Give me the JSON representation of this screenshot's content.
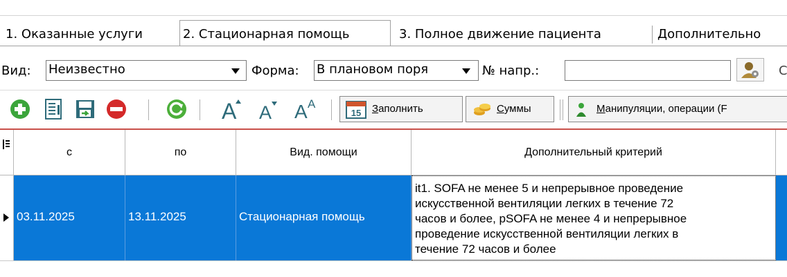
{
  "tabs": [
    {
      "label": "1. Оказанные услуги",
      "active": false
    },
    {
      "label": "2. Стационарная помощь",
      "active": true
    },
    {
      "label": "3. Полное движение пациента",
      "active": false
    },
    {
      "label": "Дополнительно",
      "active": false
    }
  ],
  "form": {
    "vid_label": "Вид:",
    "vid_value": "Неизвестно",
    "forma_label": "Форма:",
    "forma_value": "В плановом поря",
    "napr_label": "№ напр.:",
    "napr_value": "",
    "trailing_label": "С"
  },
  "toolbar": {
    "fill_key": "З",
    "fill_rest": "аполнить",
    "sums_key": "С",
    "sums_rest": "уммы",
    "manip_key": "М",
    "manip_rest": "анипуляции, операции (F",
    "calendar_day": "15",
    "icons": [
      "add-icon",
      "list-icon",
      "save-icon",
      "delete-icon",
      "refresh-icon",
      "font-increase-icon",
      "font-decrease-icon",
      "font-superscript-icon",
      "calendar-icon",
      "coins-icon",
      "person-icon",
      "user-gear-icon"
    ]
  },
  "grid": {
    "columns": [
      "с",
      "по",
      "Вид. помощи",
      "Дополнительный критерий"
    ],
    "rows": [
      {
        "from": "03.11.2025",
        "to": "13.11.2025",
        "care_type": "Стационарная помощь",
        "criterion": "it1. SOFA не менее 5 и непрерывное проведение\nискусственной вентиляции легких в течение 72\nчасов и более, pSOFA не менее 4 и непрерывное\nпроведение искусственной вентиляции легких в\nтечение 72 часов и более"
      }
    ]
  },
  "colors": {
    "selection": "#0a78d7",
    "toolbar_underline": "#c8504a",
    "add_green": "#3ba53b",
    "delete_red": "#d42a2a"
  }
}
